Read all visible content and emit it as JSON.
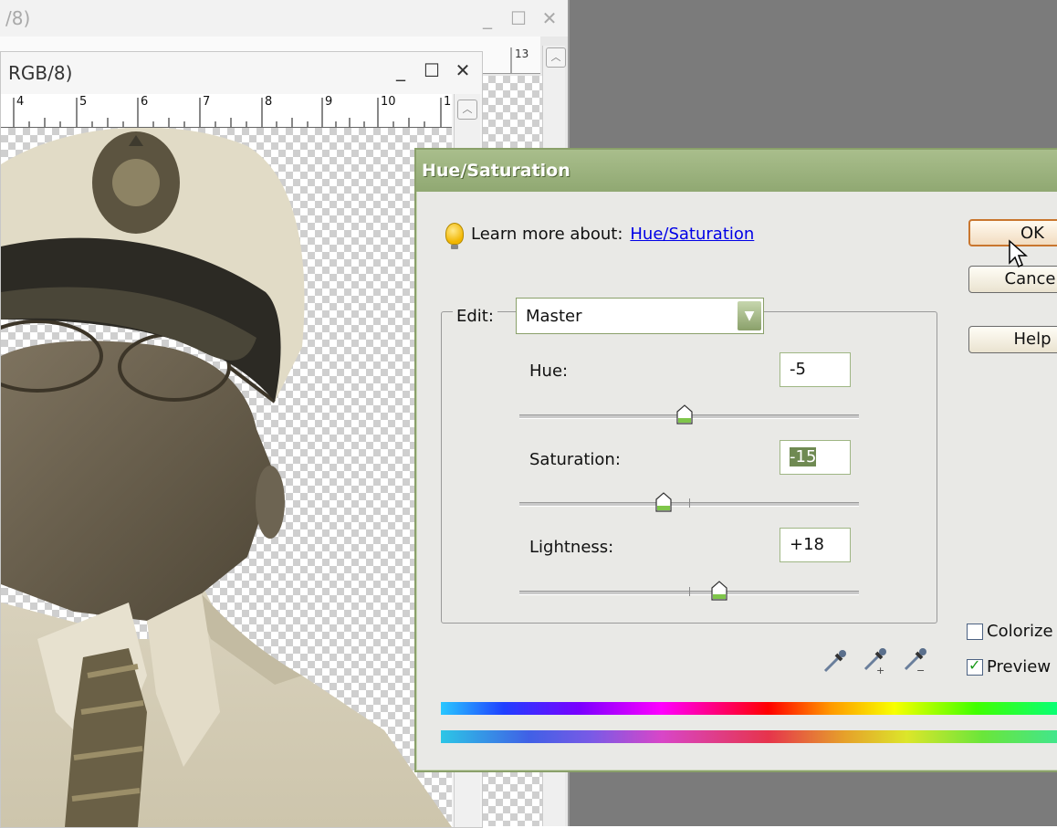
{
  "back_window": {
    "title": "/8)",
    "ruler_labels": [
      "13"
    ],
    "controls": {
      "minimize": "_",
      "maximize": "☐",
      "close": "✕"
    }
  },
  "front_window": {
    "title": "RGB/8)",
    "ruler_labels": [
      "4",
      "5",
      "6",
      "7",
      "8",
      "9",
      "10",
      "1"
    ],
    "controls": {
      "minimize": "_",
      "maximize": "☐",
      "close": "✕"
    }
  },
  "dialog": {
    "title": "Hue/Saturation",
    "learn_more_prefix": "Learn more about:",
    "learn_more_link": "Hue/Saturation",
    "edit_label": "Edit:",
    "edit_value": "Master",
    "hue_label": "Hue:",
    "hue_value": "-5",
    "saturation_label": "Saturation:",
    "saturation_value_prefix": "-",
    "saturation_value_selected": "15",
    "lightness_label": "Lightness:",
    "lightness_value": "+18",
    "buttons": {
      "ok": "OK",
      "cancel": "Cancel",
      "help": "Help"
    },
    "colorize_label": "Colorize",
    "colorize_checked": false,
    "preview_label": "Preview",
    "preview_checked": true,
    "sliders": {
      "hue": -5,
      "saturation": -15,
      "lightness": 18
    }
  },
  "colors": {
    "dialog_title_bar": "#90a872",
    "link": "#0000e6",
    "ok_border": "#c9762e",
    "workspace": "#7b7b7b"
  }
}
